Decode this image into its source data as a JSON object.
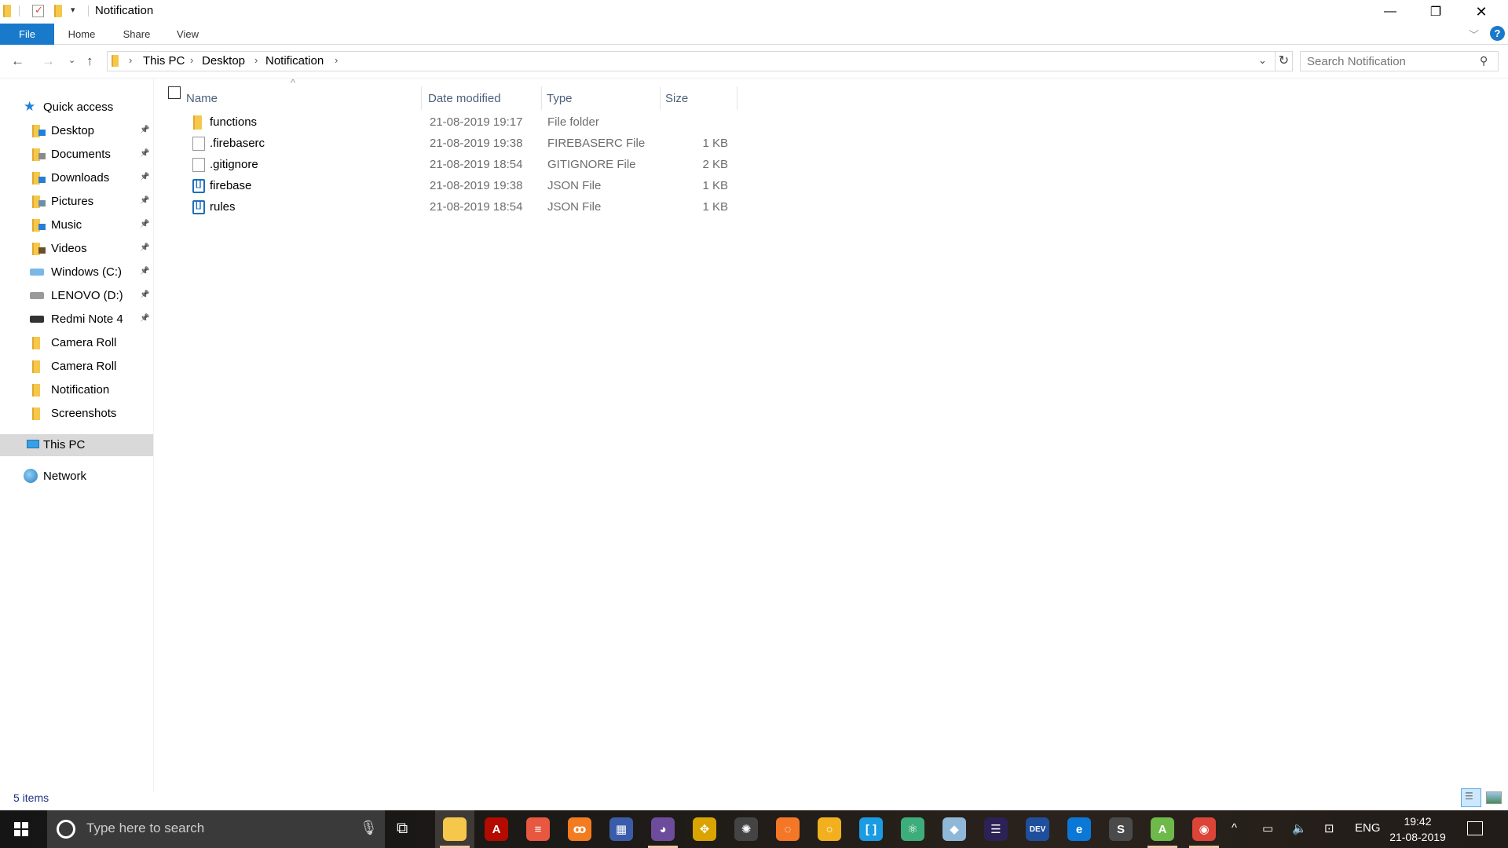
{
  "window": {
    "title": "Notification",
    "controls": {
      "minimize": "—",
      "maximize": "❐",
      "close": "✕"
    }
  },
  "ribbon": {
    "tabs": [
      {
        "label": "File",
        "active": true
      },
      {
        "label": "Home"
      },
      {
        "label": "Share"
      },
      {
        "label": "View"
      }
    ],
    "help_glyph": "?"
  },
  "address": {
    "crumbs": [
      "This PC",
      "Desktop",
      "Notification"
    ],
    "search_placeholder": "Search Notification"
  },
  "navpane": {
    "quick_access": {
      "label": "Quick access",
      "icon": "star-icon"
    },
    "items": [
      {
        "label": "Desktop",
        "icon": "desktop-folder-icon",
        "pinned": true
      },
      {
        "label": "Documents",
        "icon": "documents-folder-icon",
        "pinned": true
      },
      {
        "label": "Downloads",
        "icon": "downloads-folder-icon",
        "pinned": true
      },
      {
        "label": "Pictures",
        "icon": "pictures-folder-icon",
        "pinned": true
      },
      {
        "label": "Music",
        "icon": "music-folder-icon",
        "pinned": true
      },
      {
        "label": "Videos",
        "icon": "videos-folder-icon",
        "pinned": true
      },
      {
        "label": "Windows (C:)",
        "icon": "windows-drive-icon",
        "pinned": true
      },
      {
        "label": "LENOVO (D:)",
        "icon": "drive-icon",
        "pinned": true
      },
      {
        "label": "Redmi Note 4",
        "icon": "phone-icon",
        "pinned": true
      },
      {
        "label": "Camera Roll",
        "icon": "folder-icon",
        "pinned": false
      },
      {
        "label": "Camera Roll",
        "icon": "folder-icon",
        "pinned": false
      },
      {
        "label": "Notification",
        "icon": "folder-icon",
        "pinned": false
      },
      {
        "label": "Screenshots",
        "icon": "folder-icon",
        "pinned": false
      }
    ],
    "this_pc": {
      "label": "This PC",
      "selected": true
    },
    "network": {
      "label": "Network"
    }
  },
  "filelist": {
    "columns": [
      "Name",
      "Date modified",
      "Type",
      "Size"
    ],
    "sort_indicator": "^",
    "rows": [
      {
        "name": "functions",
        "date": "21-08-2019 19:17",
        "type": "File folder",
        "size": "",
        "icon": "folder"
      },
      {
        "name": ".firebaserc",
        "date": "21-08-2019 19:38",
        "type": "FIREBASERC File",
        "size": "1 KB",
        "icon": "file"
      },
      {
        "name": ".gitignore",
        "date": "21-08-2019 18:54",
        "type": "GITIGNORE File",
        "size": "2 KB",
        "icon": "file"
      },
      {
        "name": "firebase",
        "date": "21-08-2019 19:38",
        "type": "JSON File",
        "size": "1 KB",
        "icon": "json"
      },
      {
        "name": "rules",
        "date": "21-08-2019 18:54",
        "type": "JSON File",
        "size": "1 KB",
        "icon": "json"
      }
    ]
  },
  "status": {
    "item_count": "5 items"
  },
  "taskbar": {
    "search_placeholder": "Type here to search",
    "apps": [
      {
        "name": "file-explorer",
        "color": "#f5c84c",
        "glyph": "",
        "active": true
      },
      {
        "name": "acrobat-reader",
        "color": "#b30b00",
        "glyph": "A"
      },
      {
        "name": "sublime-merge-like",
        "color": "#e8573f",
        "glyph": "≡"
      },
      {
        "name": "xampp",
        "color": "#f37b20",
        "glyph": "ꝏ"
      },
      {
        "name": "app-grid",
        "color": "#3b5ca8",
        "glyph": "▦"
      },
      {
        "name": "github-desktop",
        "color": "#6e4c9c",
        "glyph": "◕",
        "running": true
      },
      {
        "name": "yellow-arrows-app",
        "color": "#d9a400",
        "glyph": "✥"
      },
      {
        "name": "spider-web-app",
        "color": "#444444",
        "glyph": "✺"
      },
      {
        "name": "jupyter",
        "color": "#f37726",
        "glyph": "◌"
      },
      {
        "name": "chrome-canary",
        "color": "#f2b01e",
        "glyph": "○"
      },
      {
        "name": "brackets",
        "color": "#1b9be1",
        "glyph": "[ ]"
      },
      {
        "name": "atom",
        "color": "#3dae7b",
        "glyph": "⚛"
      },
      {
        "name": "virtualbox",
        "color": "#8fb8d8",
        "glyph": "◆"
      },
      {
        "name": "eclipse",
        "color": "#2c2255",
        "glyph": "☰"
      },
      {
        "name": "dev-cpp",
        "color": "#1f4e9c",
        "glyph": "DEV"
      },
      {
        "name": "edge",
        "color": "#0b78d7",
        "glyph": "e"
      },
      {
        "name": "sublime-text",
        "color": "#4a4a4a",
        "glyph": "S"
      },
      {
        "name": "android-studio",
        "color": "#6fb84a",
        "glyph": "A",
        "running": true
      },
      {
        "name": "chrome",
        "color": "#db4437",
        "glyph": "◉",
        "running": true
      }
    ],
    "tray": {
      "chevron": "^",
      "language": "ENG",
      "time": "19:42",
      "date": "21-08-2019"
    }
  }
}
